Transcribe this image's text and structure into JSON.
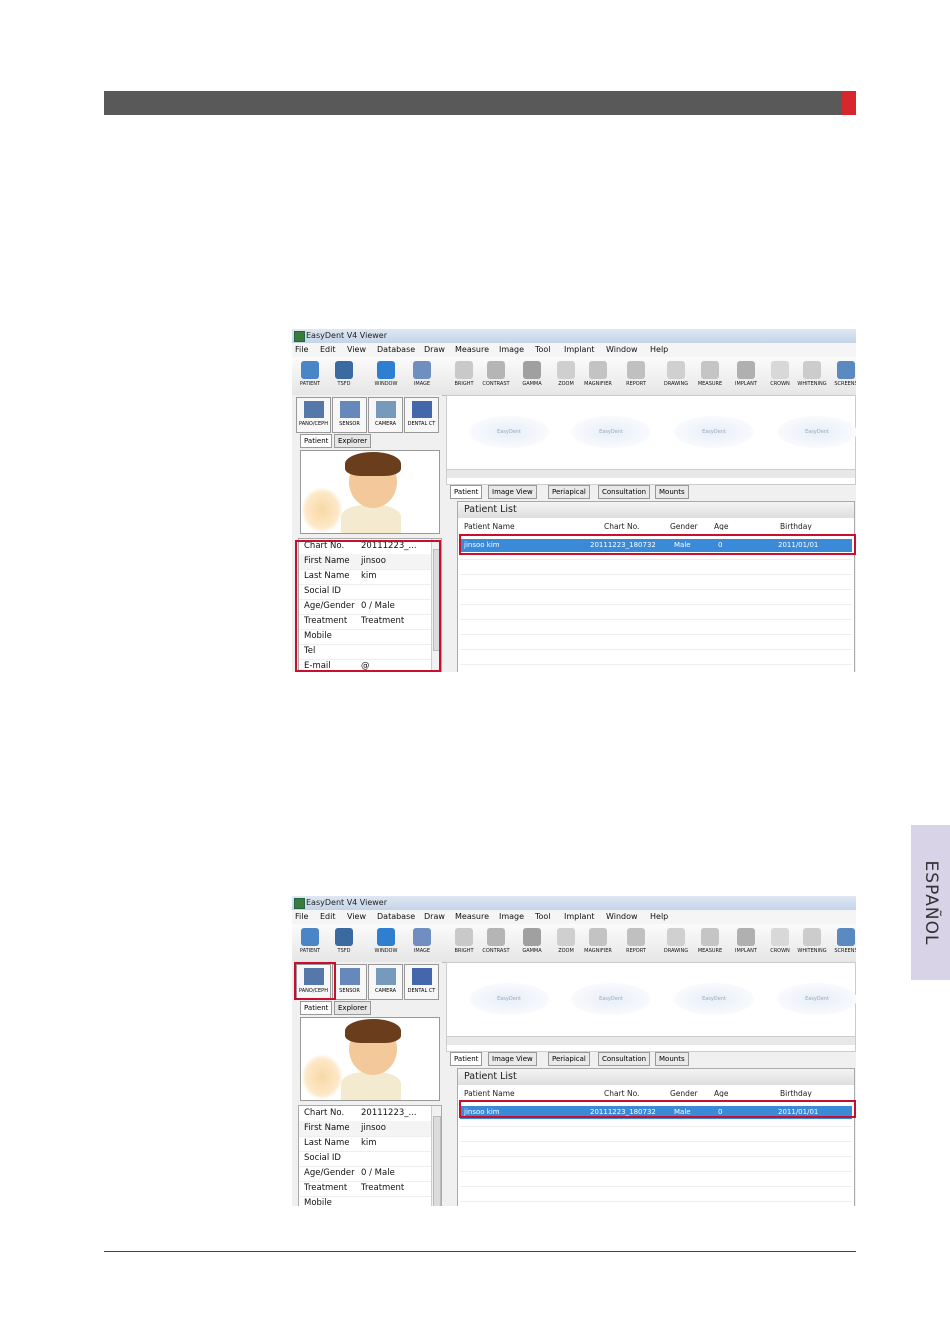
{
  "side_tab": "ESPAÑOL",
  "app": {
    "title": "EasyDent V4 Viewer",
    "menu": [
      "File",
      "Edit",
      "View",
      "Database",
      "Draw",
      "Measure",
      "Image",
      "Tool",
      "Implant",
      "Window",
      "Help"
    ],
    "toolbar": [
      "PATIENT",
      "TSFD",
      "WINDOW",
      "IMAGE",
      "BRIGHT",
      "CONTRAST",
      "GAMMA",
      "ZOOM",
      "MAGNIFIER",
      "REPORT",
      "DRAWING",
      "MEASURE",
      "IMPLANT",
      "CROWN",
      "WHITENING",
      "SCREENS"
    ],
    "toolbar2": [
      "PANO/CEPH",
      "SENSOR",
      "CAMERA",
      "DENTAL CT"
    ],
    "thumb_label": "EasyDent",
    "left_tabs": [
      "Patient",
      "Explorer"
    ],
    "right_tabs": [
      "Patient",
      "Image View",
      "Periapical",
      "Consultation",
      "Mounts"
    ],
    "patient_list_title": "Patient List",
    "columns": [
      "Patient Name",
      "Chart No.",
      "Gender",
      "Age",
      "Birthday"
    ],
    "selected_row": {
      "name": "jinsoo kim",
      "chart": "20111223_180732",
      "gender": "Male",
      "age": "0",
      "birthday": "2011/01/01"
    },
    "info_rows_1": [
      {
        "k": "Chart No.",
        "v": "20111223_..."
      },
      {
        "k": "First Name",
        "v": "jinsoo"
      },
      {
        "k": "Last Name",
        "v": "kim"
      },
      {
        "k": "Social ID",
        "v": ""
      },
      {
        "k": "Age/Gender",
        "v": "0 / Male"
      },
      {
        "k": "Treatment",
        "v": "Treatment"
      },
      {
        "k": "Mobile",
        "v": ""
      },
      {
        "k": "Tel",
        "v": ""
      },
      {
        "k": "E-mail",
        "v": "@"
      }
    ],
    "info_rows_2": [
      {
        "k": "Chart No.",
        "v": "20111223_..."
      },
      {
        "k": "First Name",
        "v": "jinsoo"
      },
      {
        "k": "Last Name",
        "v": "kim"
      },
      {
        "k": "Social ID",
        "v": ""
      },
      {
        "k": "Age/Gender",
        "v": "0 / Male"
      },
      {
        "k": "Treatment",
        "v": "Treatment"
      },
      {
        "k": "Mobile",
        "v": ""
      }
    ]
  }
}
